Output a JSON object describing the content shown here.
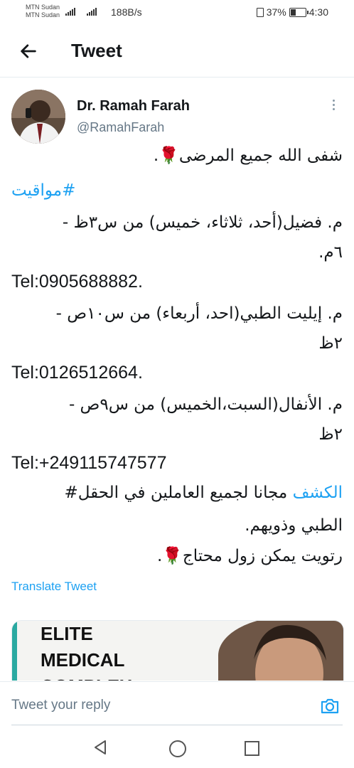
{
  "status_bar": {
    "carrier_1": "MTN Sudan",
    "carrier_2": "MTN Sudan",
    "net_1": "4G",
    "net_2": "3G",
    "speed": "188B/s",
    "battery": "37%",
    "time": "4:30"
  },
  "header": {
    "title": "Tweet",
    "back_icon": "arrow-left-icon"
  },
  "tweet": {
    "author_name": "Dr. Ramah Farah",
    "author_handle": "@RamahFarah",
    "lines": [
      "شفى الله جميع المرضى",
      "#مواقيت",
      "م. فضيل(أحد، ثلاثاء، خميس) من س٣ظ -",
      "٦م.",
      "Tel:0905688882.",
      "م. إيليت الطبي(احد، أربعاء) من س١٠ص -",
      "٢ظ",
      "Tel:0126512664.",
      "م. الأنفال(السبت،الخميس) من س٩ص -",
      "٢ظ",
      "Tel:+249115747577",
      "الكشف",
      " مجانا لجميع العاملين في الحقل#",
      "الطبي وذويهم.",
      "رتويت يمكن زول محتاج"
    ],
    "dot": ".",
    "emoji_rose": "🌹",
    "translate": "Translate Tweet"
  },
  "media_card": {
    "line1": "ELITE",
    "line2": "MEDICAL",
    "line3": "COMPLEX",
    "accent": "#2aa9a1"
  },
  "reply": {
    "placeholder": "Tweet your reply"
  },
  "colors": {
    "link": "#1da1f2",
    "secondary": "#657786",
    "text": "#14171a"
  }
}
